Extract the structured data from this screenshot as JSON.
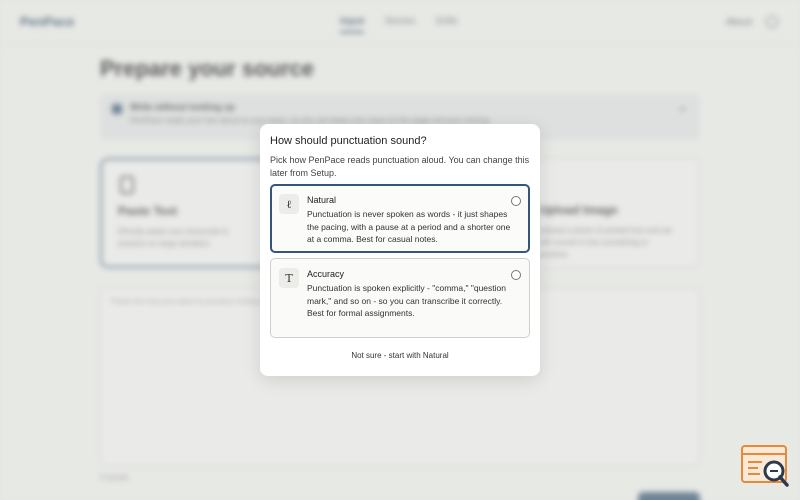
{
  "app": {
    "logo": "PenPace",
    "nav": [
      "Input",
      "Stories",
      "Drills"
    ],
    "nav_active_index": 0,
    "topright_link": "About",
    "page_title": "Prepare your source",
    "banner": {
      "title": "Write without looking up",
      "text": "PenPace reads your text aloud at your pace, so you can keep your eyes on the page and pen moving."
    },
    "cards": {
      "left": {
        "title": "Paste Text",
        "text": "Directly paste your transcript to practice on large dictation."
      },
      "right": {
        "title": "Upload Image",
        "text": "Upload a photo of printed text and we will convert it into something to practice."
      }
    },
    "textarea_placeholder": "Paste the text you want to practice writing here",
    "word_count": "0 words"
  },
  "modal": {
    "title": "How should punctuation sound?",
    "description": "Pick how PenPace reads punctuation aloud. You can change this later from Setup.",
    "options": [
      {
        "icon": "pen-nib-icon",
        "icon_glyph": "ℓ",
        "title": "Natural",
        "text": "Punctuation is never spoken as words - it just shapes the pacing, with a pause at a period and a shorter one at a comma. Best for casual notes.",
        "selected": true
      },
      {
        "icon": "text-t-icon",
        "icon_glyph": "T",
        "title": "Accuracy",
        "text": "Punctuation is spoken explicitly - \"comma,\" \"question mark,\" and so on - so you can transcribe it correctly. Best for formal assignments.",
        "selected": false
      }
    ],
    "footer_link": "Not sure - start with Natural"
  },
  "colors": {
    "accent": "#34567a",
    "background": "#eceeea",
    "badge_orange": "#e8893a"
  }
}
